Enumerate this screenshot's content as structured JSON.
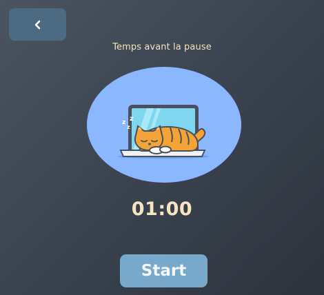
{
  "header": {
    "back_icon": "chevron-left-icon"
  },
  "subtitle": "Temps avant la pause",
  "illustration": {
    "icon": "sleeping-cat-on-laptop-icon",
    "sleep_letters": "z z z"
  },
  "timer": {
    "value": "01:00"
  },
  "start_button": {
    "label": "Start"
  },
  "colors": {
    "background": "#3a434f",
    "back_button": "#4d6a83",
    "accent_text": "#f6e3bf",
    "circle": "#8ab7ff",
    "start_button": "#78a9cb"
  }
}
